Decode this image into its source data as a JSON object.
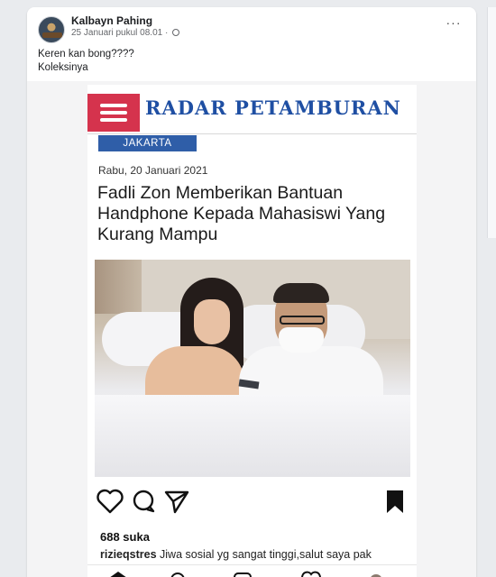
{
  "post": {
    "author": "Kalbayn Pahing",
    "timestamp": "25 Januari pukul 08.01 ·",
    "caption_lines": [
      "Keren kan bong????",
      "Koleksinya"
    ],
    "more_icon": "more-horizontal-icon",
    "privacy_icon": "globe-icon"
  },
  "shared_image": {
    "site_name": "RADAR PETAMBURAN",
    "section_tag": "JAKARTA",
    "article_date": "Rabu, 20 Januari 2021",
    "headline": "Fadli Zon Memberikan Bantuan Handphone Kepada Mahasiswi Yang Kurang Mampu",
    "likes": "688 suka",
    "comment_user": "rizieqstres",
    "comment_text": "Jiwa sosial yg sangat tinggi,salut saya pak",
    "colors": {
      "site_accent": "#d5334d",
      "site_blue": "#1f4fa3",
      "tag_blue": "#2f5ea8"
    },
    "icons": {
      "like": "heart-icon",
      "comment": "comment-bubble-icon",
      "share": "send-icon",
      "save": "bookmark-icon",
      "menu": "hamburger-menu-icon"
    }
  }
}
